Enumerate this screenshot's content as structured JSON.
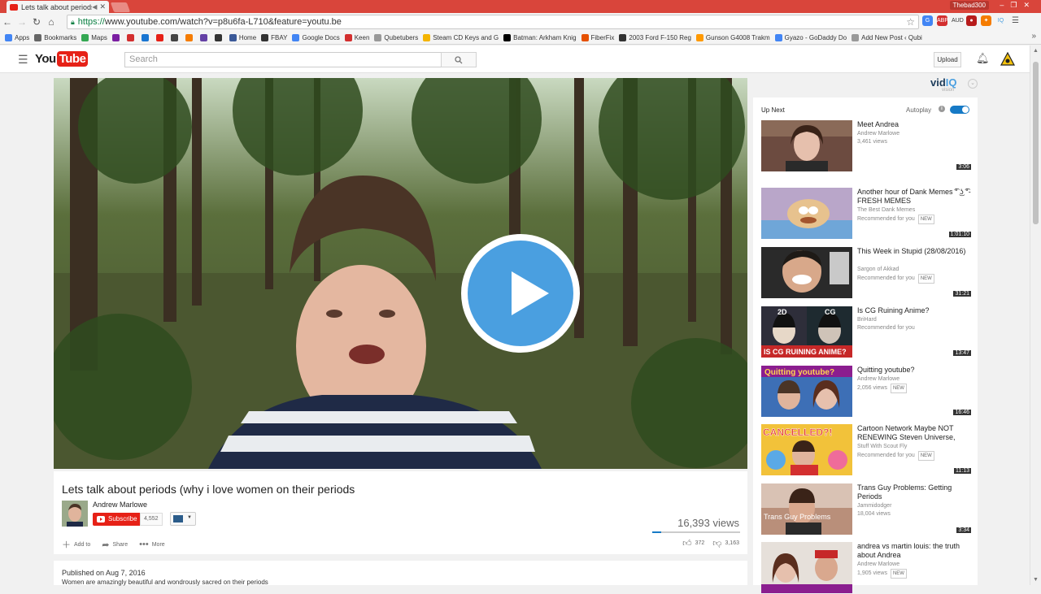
{
  "browser": {
    "tab_title": "Lets talk about periods",
    "url_scheme": "https://",
    "url_rest": "www.youtube.com/watch?v=p8u6fa-L710&feature=youtu.be",
    "user_name": "Thebad300",
    "bookmarks": [
      {
        "label": "Apps",
        "color": "#4285f4"
      },
      {
        "label": "Bookmarks",
        "color": "#666666"
      },
      {
        "label": "Maps",
        "color": "#34a853"
      },
      {
        "label": "",
        "color": "#7b1fa2"
      },
      {
        "label": "",
        "color": "#d32f2f"
      },
      {
        "label": "",
        "color": "#1976d2"
      },
      {
        "label": "",
        "color": "#e62117"
      },
      {
        "label": "",
        "color": "#444444"
      },
      {
        "label": "",
        "color": "#f57c00"
      },
      {
        "label": "",
        "color": "#6441a5"
      },
      {
        "label": "",
        "color": "#333333"
      },
      {
        "label": "Home",
        "color": "#3b5998"
      },
      {
        "label": "FBAY",
        "color": "#333333"
      },
      {
        "label": "Google Docs",
        "color": "#4285f4"
      },
      {
        "label": "Keen",
        "color": "#d32f2f"
      },
      {
        "label": "Qubetubers",
        "color": "#999999"
      },
      {
        "label": "Steam CD Keys and G",
        "color": "#f4b400"
      },
      {
        "label": "Batman: Arkham Knig",
        "color": "#000000"
      },
      {
        "label": "FiberFix",
        "color": "#e65100"
      },
      {
        "label": "2003 Ford F-150 Reg",
        "color": "#333333"
      },
      {
        "label": "Gunson G4008 Trakm",
        "color": "#ff9900"
      },
      {
        "label": "Gyazo - GoDaddy Do",
        "color": "#4285f4"
      },
      {
        "label": "Add New Post ‹ Qubi",
        "color": "#999999"
      }
    ]
  },
  "masthead": {
    "logo_you": "You",
    "logo_tube": "Tube",
    "search_placeholder": "Search",
    "upload_label": "Upload"
  },
  "video": {
    "title": "Lets talk about periods (why i love women on their periods",
    "channel": "Andrew Marlowe",
    "subscribe_label": "Subscribe",
    "subscriber_count": "4,552",
    "views": "16,393 views",
    "add_to": "Add to",
    "share": "Share",
    "more": "More",
    "likes": "372",
    "dislikes": "3,163",
    "published": "Published on Aug 7, 2016",
    "description": "Women are amazingly beautiful and wondrously sacred on their periods"
  },
  "sidebar": {
    "vidiq_logo": "vidIQ",
    "vidiq_sub": "vision",
    "up_next": "Up Next",
    "autoplay": "Autoplay",
    "items": [
      {
        "title": "Meet Andrea",
        "channel": "Andrew Marlowe",
        "meta": "3,461 views",
        "duration": "3:06",
        "new": ""
      },
      {
        "title": "Another hour of Dank Memes ͡° ͜ʖ ͡°- FRESH MEMES",
        "channel": "The Best Dank Memes",
        "meta": "Recommended for you",
        "duration": "1:01:10",
        "new": "NEW"
      },
      {
        "title": "This Week in Stupid (28/08/2016)",
        "channel": "Sargon of Akkad",
        "meta": "Recommended for you",
        "duration": "31:21",
        "new": "NEW"
      },
      {
        "title": "Is CG Ruining Anime?",
        "channel": "BriHard",
        "meta": "Recommended for you",
        "duration": "13:47",
        "new": ""
      },
      {
        "title": "Quitting youtube?",
        "channel": "Andrew Marlowe",
        "meta": "2,056 views",
        "duration": "16:46",
        "new": "NEW"
      },
      {
        "title": "Cartoon Network Maybe NOT RENEWING Steven Universe,",
        "channel": "Stuff With Scout Fly",
        "meta": "Recommended for you",
        "duration": "11:13",
        "new": "NEW"
      },
      {
        "title": "Trans Guy Problems: Getting Periods",
        "channel": "Jammidodger",
        "meta": "18,004 views",
        "duration": "3:34",
        "new": ""
      },
      {
        "title": "andrea vs martin louis: the truth about Andrea",
        "channel": "Andrew Marlowe",
        "meta": "1,905 views",
        "duration": "",
        "new": "NEW"
      }
    ],
    "thumb_text": {
      "cg_left": "2D",
      "cg_right": "CG",
      "cg_caption": "IS CG RUINING ANIME?",
      "quit": "Quitting youtube?",
      "cancelled": "CANCELLED?!",
      "trans": "Trans Guy Problems"
    }
  }
}
